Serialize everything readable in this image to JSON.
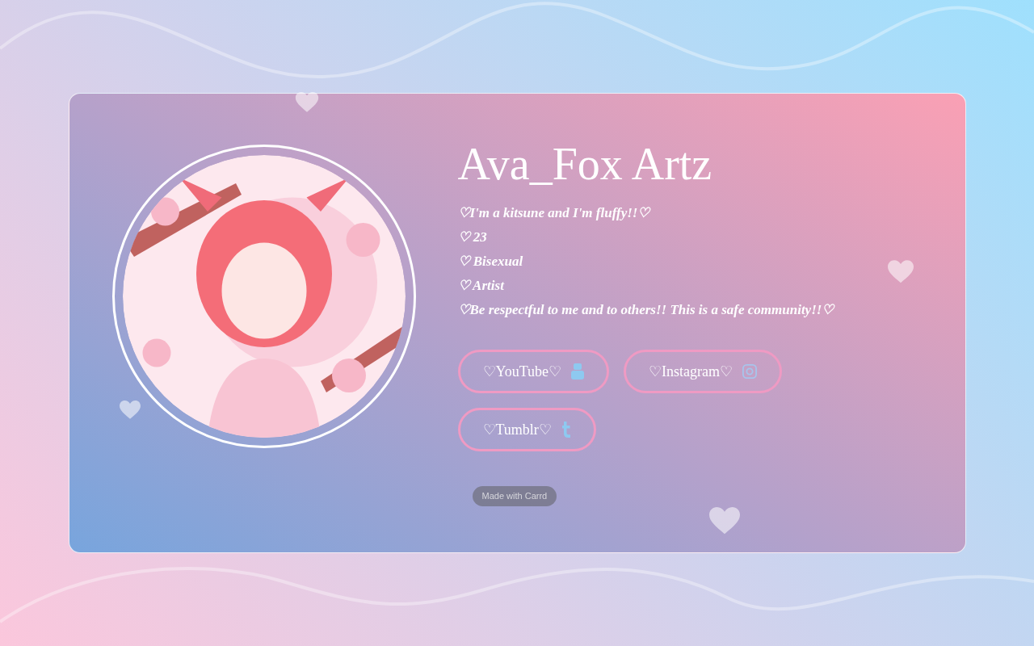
{
  "profile": {
    "name": "Ava_Fox Artz",
    "bio": [
      "♡I'm a kitsune and I'm fluffy!!♡",
      "♡ 23",
      "♡ Bisexual",
      "♡ Artist",
      "♡Be respectful to me and to others!! This is a safe community!!♡"
    ],
    "links": [
      {
        "label": "♡YouTube♡",
        "kind": "youtube"
      },
      {
        "label": "♡Instagram♡",
        "kind": "instagram"
      },
      {
        "label": "♡Tumblr♡",
        "kind": "tumblr"
      }
    ],
    "footer_badge": "Made with Carrd"
  }
}
